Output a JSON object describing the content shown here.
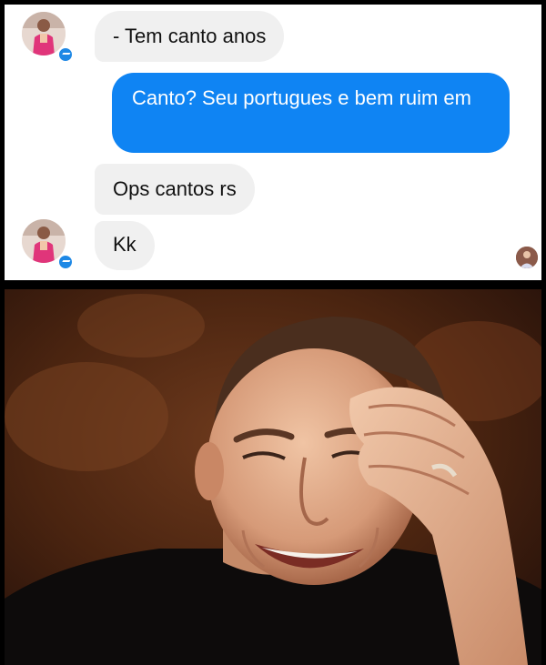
{
  "conversation": {
    "messages": [
      {
        "sender": "contact",
        "text": "- Tem canto anos"
      },
      {
        "sender": "me",
        "text": "Canto? Seu portugues e bem ruim em"
      },
      {
        "sender": "contact",
        "text": "Ops cantos rs"
      },
      {
        "sender": "contact",
        "text": "Kk"
      }
    ],
    "icons": {
      "contact_avatar": "profile-photo-icon",
      "messenger_badge": "messenger-icon",
      "seen_indicator": "seen-avatar-icon"
    },
    "colors": {
      "outgoing_bubble": "#0f84f3",
      "incoming_bubble": "#f0f0f0"
    }
  },
  "reaction_image": {
    "subject": "man laughing with hand on forehead"
  }
}
